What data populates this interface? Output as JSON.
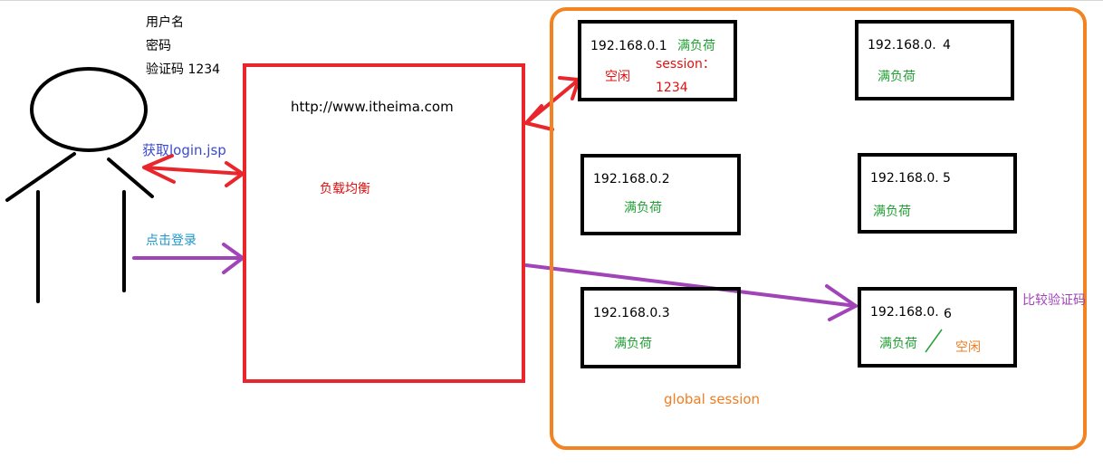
{
  "credentials": {
    "username": "用户名",
    "password": "密码",
    "captcha": "验证码  1234"
  },
  "load_balancer": {
    "url": "http://www.itheima.com",
    "label": "负载均衡"
  },
  "arrows": {
    "get_login": "获取login.jsp",
    "click_login": "点击登录"
  },
  "servers": [
    {
      "ip": "192.168.0.1",
      "status": "满负荷",
      "note": "空闲",
      "session_label": "session：",
      "session_value": "1234"
    },
    {
      "ip": "192.168.0.2",
      "status": "满负荷"
    },
    {
      "ip": "192.168.0.3",
      "status": "满负荷"
    },
    {
      "ip_prefix": "192.168.0.",
      "ip_suffix": "4",
      "status": "满负荷"
    },
    {
      "ip_prefix": "192.168.0.",
      "ip_suffix": "5",
      "status": "满负荷"
    },
    {
      "ip_prefix": "192.168.0.",
      "ip_suffix": "6",
      "status": "满负荷",
      "note": "空闲"
    }
  ],
  "compare_captcha": "比较验证码",
  "global_session": "global session",
  "colors": {
    "lb_border": "#e8262c",
    "cluster_border": "#f38220",
    "status_green": "#22a034",
    "request_red": "#e01010",
    "submit_purple": "#a044b8"
  }
}
